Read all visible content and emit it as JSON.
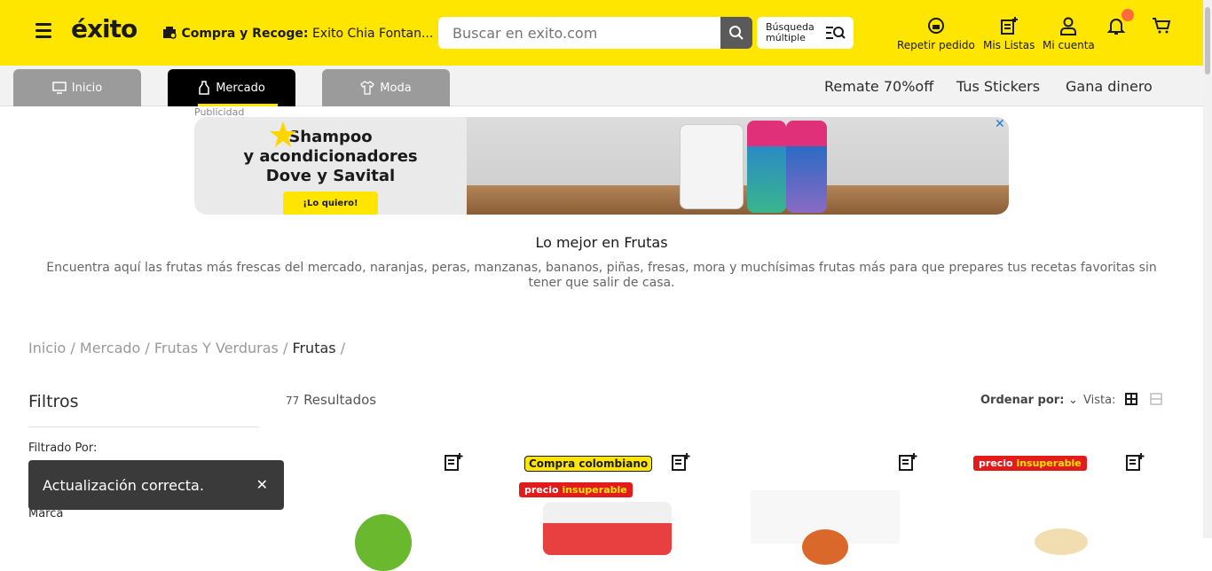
{
  "header": {
    "logo": "éxito",
    "pickup_label": "Compra y Recoge:",
    "pickup_store": "Exito Chia Fontan...",
    "search_placeholder": "Buscar en exito.com",
    "multi_search_line1": "Búsqueda",
    "multi_search_line2": "múltiple",
    "actions": [
      {
        "label": "Repetir pedido",
        "icon": "repeat-order-icon"
      },
      {
        "label": "Mis Listas",
        "icon": "lists-icon"
      },
      {
        "label": "Mi cuenta",
        "icon": "account-icon"
      }
    ]
  },
  "nav": {
    "tabs": [
      {
        "label": "Inicio",
        "icon": "monitor-icon"
      },
      {
        "label": "Mercado",
        "icon": "bottle-icon"
      },
      {
        "label": "Moda",
        "icon": "shirt-icon"
      }
    ],
    "links": [
      "Remate 70%off",
      "Tus Stickers",
      "Gana dinero"
    ]
  },
  "banner": {
    "label": "Publicidad",
    "line1": "Shampoo",
    "line2": "y acondicionadores",
    "line3": "Dove y Savital",
    "cta": "¡Lo quiero!"
  },
  "category": {
    "title": "Lo mejor en Frutas",
    "description": "Encuentra aquí las frutas más frescas del mercado, naranjas, peras, manzanas, bananos, piñas, fresas, mora y muchísimas frutas más para que prepares tus recetas favoritas sin tener que salir de casa."
  },
  "breadcrumb": [
    "Inicio",
    "Mercado",
    "Frutas Y Verduras",
    "Frutas"
  ],
  "filters": {
    "title": "Filtros",
    "filtered_by": "Filtrado Por:",
    "brand": "Marca"
  },
  "results": {
    "count": "77",
    "label": "Resultados"
  },
  "sort": {
    "label": "Ordenar por:",
    "view_label": "Vista:"
  },
  "badges": {
    "colombian": "Compra colombiano",
    "unbeatable_a": "precio",
    "unbeatable_b": "insuperable"
  },
  "toast": {
    "message": "Actualización correcta."
  },
  "colors": {
    "brand": "#ffe600",
    "badge_red": "#e21b1b"
  }
}
